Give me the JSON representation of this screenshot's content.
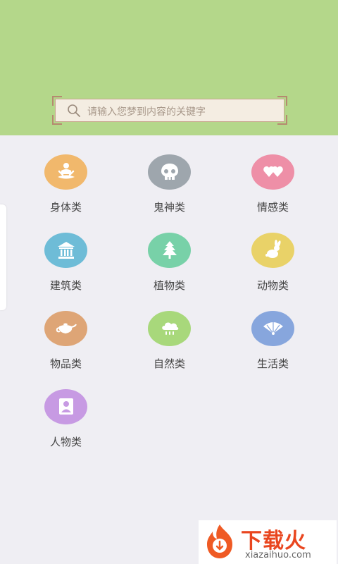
{
  "search": {
    "placeholder": "请输入您梦到内容的关键字"
  },
  "categories": [
    {
      "label": "身体类",
      "color": "#f1b86c",
      "icon": "meditation-person-icon"
    },
    {
      "label": "鬼神类",
      "color": "#9ea6ad",
      "icon": "skull-icon"
    },
    {
      "label": "情感类",
      "color": "#ee8fa7",
      "icon": "two-hearts-icon"
    },
    {
      "label": "建筑类",
      "color": "#6ebcd7",
      "icon": "temple-building-icon"
    },
    {
      "label": "植物类",
      "color": "#78d1a8",
      "icon": "pine-tree-icon"
    },
    {
      "label": "动物类",
      "color": "#e9d268",
      "icon": "rabbit-icon"
    },
    {
      "label": "物品类",
      "color": "#dea576",
      "icon": "teapot-icon"
    },
    {
      "label": "自然类",
      "color": "#a8d87b",
      "icon": "rain-cloud-icon"
    },
    {
      "label": "生活类",
      "color": "#87a6dd",
      "icon": "folding-fan-icon"
    },
    {
      "label": "人物类",
      "color": "#c79ae3",
      "icon": "person-icon"
    }
  ],
  "watermark": {
    "brand": "下载火",
    "domain": "xiazaihuo.com"
  }
}
